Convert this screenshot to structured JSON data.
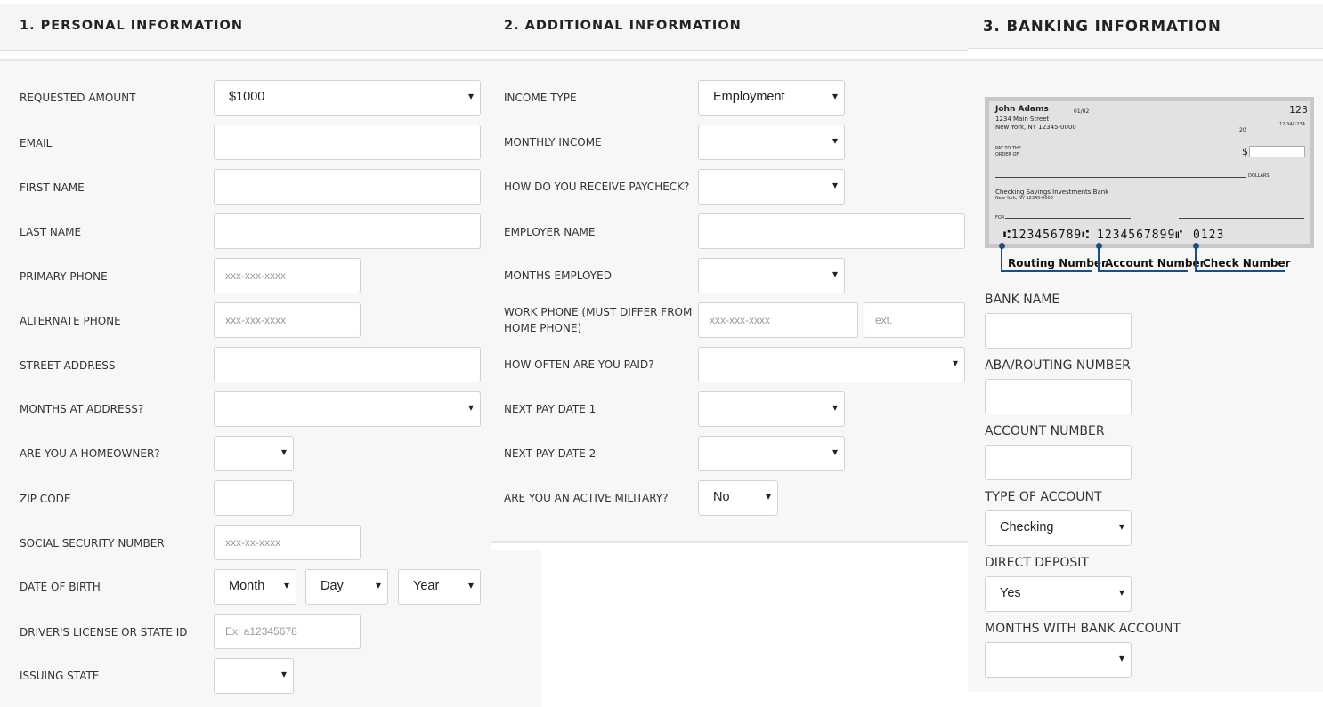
{
  "sections": {
    "personal": "1. PERSONAL INFORMATION",
    "additional": "2. ADDITIONAL INFORMATION",
    "banking": "3. BANKING INFORMATION"
  },
  "personal": {
    "requested_amount": {
      "label": "REQUESTED AMOUNT",
      "value": "$1000"
    },
    "email": {
      "label": "EMAIL"
    },
    "first_name": {
      "label": "FIRST NAME"
    },
    "last_name": {
      "label": "LAST NAME"
    },
    "primary_phone": {
      "label": "PRIMARY PHONE",
      "placeholder": "xxx-xxx-xxxx"
    },
    "alternate_phone": {
      "label": "ALTERNATE PHONE",
      "placeholder": "xxx-xxx-xxxx"
    },
    "street_address": {
      "label": "STREET ADDRESS"
    },
    "months_at_address": {
      "label": "MONTHS AT ADDRESS?"
    },
    "homeowner": {
      "label": "ARE YOU A HOMEOWNER?"
    },
    "zip_code": {
      "label": "ZIP CODE"
    },
    "ssn": {
      "label": "SOCIAL SECURITY NUMBER",
      "placeholder": "xxx-xx-xxxx"
    },
    "dob": {
      "label": "DATE OF BIRTH",
      "month": "Month",
      "day": "Day",
      "year": "Year"
    },
    "drivers_license": {
      "label": "DRIVER'S LICENSE OR STATE ID",
      "placeholder": "Ex: a12345678"
    },
    "issuing_state": {
      "label": "ISSUING STATE"
    }
  },
  "additional": {
    "income_type": {
      "label": "INCOME TYPE",
      "value": "Employment"
    },
    "monthly_income": {
      "label": "MONTHLY INCOME"
    },
    "receive_paycheck": {
      "label": "HOW DO YOU RECEIVE PAYCHECK?"
    },
    "employer_name": {
      "label": "EMPLOYER NAME"
    },
    "months_employed": {
      "label": "MONTHS EMPLOYED"
    },
    "work_phone": {
      "label_line1": "WORK PHONE (MUST DIFFER FROM",
      "label_line2": "HOME PHONE)",
      "placeholder": "xxx-xxx-xxxx",
      "ext_placeholder": "ext."
    },
    "pay_frequency": {
      "label": "HOW OFTEN ARE YOU PAID?"
    },
    "next_pay_date_1": {
      "label": "NEXT PAY DATE 1"
    },
    "next_pay_date_2": {
      "label": "NEXT PAY DATE 2"
    },
    "active_military": {
      "label": "ARE YOU AN ACTIVE MILITARY?",
      "value": "No"
    }
  },
  "banking": {
    "check": {
      "name": "John Adams",
      "street": "1234 Main Street",
      "city": "New York, NY 12345-0000",
      "date_code": "01/02",
      "number": "123",
      "fraction": "12-34/1234",
      "year_prefix": "20",
      "pay_to_1": "PAY TO THE",
      "pay_to_2": "ORDER OF",
      "dollar_sign": "$",
      "dollars": "DOLLARS",
      "bank_name": "Checking Savings Investments Bank",
      "bank_city": "New York, NY 12345-0000",
      "for": "FOR",
      "micr_routing": "⑆123456789⑆",
      "micr_account": "1234567899⑈",
      "micr_check": "0123",
      "routing_label": "Routing Number",
      "account_label": "Account Number",
      "check_label": "Check Number"
    },
    "bank_name": {
      "label": "BANK NAME"
    },
    "routing_number": {
      "label": "ABA/ROUTING NUMBER"
    },
    "account_number": {
      "label": "ACCOUNT NUMBER"
    },
    "account_type": {
      "label": "TYPE OF ACCOUNT",
      "value": "Checking"
    },
    "direct_deposit": {
      "label": "DIRECT DEPOSIT",
      "value": "Yes"
    },
    "months_with_bank": {
      "label": "MONTHS WITH BANK ACCOUNT"
    }
  },
  "icons": {
    "caret": "▾"
  }
}
